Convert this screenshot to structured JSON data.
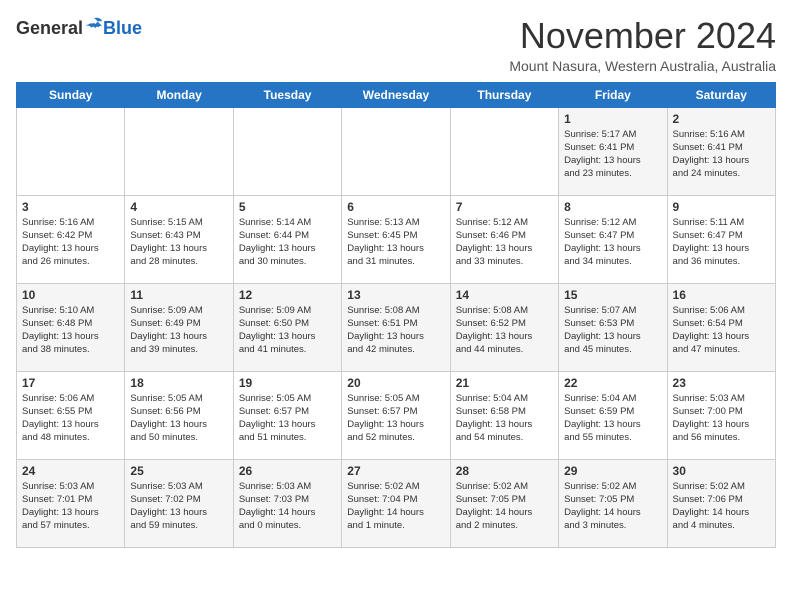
{
  "header": {
    "logo_general": "General",
    "logo_blue": "Blue",
    "month_title": "November 2024",
    "location": "Mount Nasura, Western Australia, Australia"
  },
  "days_of_week": [
    "Sunday",
    "Monday",
    "Tuesday",
    "Wednesday",
    "Thursday",
    "Friday",
    "Saturday"
  ],
  "weeks": [
    [
      {
        "day": "",
        "info": ""
      },
      {
        "day": "",
        "info": ""
      },
      {
        "day": "",
        "info": ""
      },
      {
        "day": "",
        "info": ""
      },
      {
        "day": "",
        "info": ""
      },
      {
        "day": "1",
        "info": "Sunrise: 5:17 AM\nSunset: 6:41 PM\nDaylight: 13 hours\nand 23 minutes."
      },
      {
        "day": "2",
        "info": "Sunrise: 5:16 AM\nSunset: 6:41 PM\nDaylight: 13 hours\nand 24 minutes."
      }
    ],
    [
      {
        "day": "3",
        "info": "Sunrise: 5:16 AM\nSunset: 6:42 PM\nDaylight: 13 hours\nand 26 minutes."
      },
      {
        "day": "4",
        "info": "Sunrise: 5:15 AM\nSunset: 6:43 PM\nDaylight: 13 hours\nand 28 minutes."
      },
      {
        "day": "5",
        "info": "Sunrise: 5:14 AM\nSunset: 6:44 PM\nDaylight: 13 hours\nand 30 minutes."
      },
      {
        "day": "6",
        "info": "Sunrise: 5:13 AM\nSunset: 6:45 PM\nDaylight: 13 hours\nand 31 minutes."
      },
      {
        "day": "7",
        "info": "Sunrise: 5:12 AM\nSunset: 6:46 PM\nDaylight: 13 hours\nand 33 minutes."
      },
      {
        "day": "8",
        "info": "Sunrise: 5:12 AM\nSunset: 6:47 PM\nDaylight: 13 hours\nand 34 minutes."
      },
      {
        "day": "9",
        "info": "Sunrise: 5:11 AM\nSunset: 6:47 PM\nDaylight: 13 hours\nand 36 minutes."
      }
    ],
    [
      {
        "day": "10",
        "info": "Sunrise: 5:10 AM\nSunset: 6:48 PM\nDaylight: 13 hours\nand 38 minutes."
      },
      {
        "day": "11",
        "info": "Sunrise: 5:09 AM\nSunset: 6:49 PM\nDaylight: 13 hours\nand 39 minutes."
      },
      {
        "day": "12",
        "info": "Sunrise: 5:09 AM\nSunset: 6:50 PM\nDaylight: 13 hours\nand 41 minutes."
      },
      {
        "day": "13",
        "info": "Sunrise: 5:08 AM\nSunset: 6:51 PM\nDaylight: 13 hours\nand 42 minutes."
      },
      {
        "day": "14",
        "info": "Sunrise: 5:08 AM\nSunset: 6:52 PM\nDaylight: 13 hours\nand 44 minutes."
      },
      {
        "day": "15",
        "info": "Sunrise: 5:07 AM\nSunset: 6:53 PM\nDaylight: 13 hours\nand 45 minutes."
      },
      {
        "day": "16",
        "info": "Sunrise: 5:06 AM\nSunset: 6:54 PM\nDaylight: 13 hours\nand 47 minutes."
      }
    ],
    [
      {
        "day": "17",
        "info": "Sunrise: 5:06 AM\nSunset: 6:55 PM\nDaylight: 13 hours\nand 48 minutes."
      },
      {
        "day": "18",
        "info": "Sunrise: 5:05 AM\nSunset: 6:56 PM\nDaylight: 13 hours\nand 50 minutes."
      },
      {
        "day": "19",
        "info": "Sunrise: 5:05 AM\nSunset: 6:57 PM\nDaylight: 13 hours\nand 51 minutes."
      },
      {
        "day": "20",
        "info": "Sunrise: 5:05 AM\nSunset: 6:57 PM\nDaylight: 13 hours\nand 52 minutes."
      },
      {
        "day": "21",
        "info": "Sunrise: 5:04 AM\nSunset: 6:58 PM\nDaylight: 13 hours\nand 54 minutes."
      },
      {
        "day": "22",
        "info": "Sunrise: 5:04 AM\nSunset: 6:59 PM\nDaylight: 13 hours\nand 55 minutes."
      },
      {
        "day": "23",
        "info": "Sunrise: 5:03 AM\nSunset: 7:00 PM\nDaylight: 13 hours\nand 56 minutes."
      }
    ],
    [
      {
        "day": "24",
        "info": "Sunrise: 5:03 AM\nSunset: 7:01 PM\nDaylight: 13 hours\nand 57 minutes."
      },
      {
        "day": "25",
        "info": "Sunrise: 5:03 AM\nSunset: 7:02 PM\nDaylight: 13 hours\nand 59 minutes."
      },
      {
        "day": "26",
        "info": "Sunrise: 5:03 AM\nSunset: 7:03 PM\nDaylight: 14 hours\nand 0 minutes."
      },
      {
        "day": "27",
        "info": "Sunrise: 5:02 AM\nSunset: 7:04 PM\nDaylight: 14 hours\nand 1 minute."
      },
      {
        "day": "28",
        "info": "Sunrise: 5:02 AM\nSunset: 7:05 PM\nDaylight: 14 hours\nand 2 minutes."
      },
      {
        "day": "29",
        "info": "Sunrise: 5:02 AM\nSunset: 7:05 PM\nDaylight: 14 hours\nand 3 minutes."
      },
      {
        "day": "30",
        "info": "Sunrise: 5:02 AM\nSunset: 7:06 PM\nDaylight: 14 hours\nand 4 minutes."
      }
    ]
  ]
}
